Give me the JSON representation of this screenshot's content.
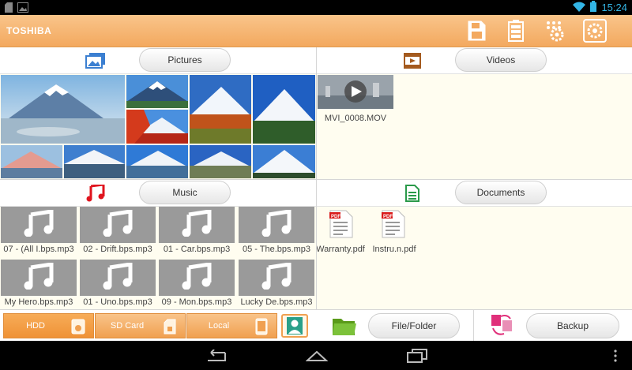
{
  "status_bar": {
    "time": "15:24",
    "left_icons": [
      "sd-card-notification-icon",
      "image-notification-icon"
    ],
    "right_icons": [
      "wifi-icon",
      "battery-icon"
    ]
  },
  "app": {
    "brand": "TOSHIBA",
    "accent": "#f5b26b",
    "header_icons": [
      "save-icon",
      "battery-status-icon",
      "settings-cluster-icon",
      "gear-icon"
    ]
  },
  "pictures": {
    "label": "Pictures",
    "icon": "pictures-icon"
  },
  "videos": {
    "label": "Videos",
    "icon": "film-icon",
    "items": [
      {
        "name": "MVI_0008.MOV"
      }
    ]
  },
  "music": {
    "label": "Music",
    "icon": "music-note-icon",
    "items": [
      {
        "name": "07 - (All I.bps.mp3"
      },
      {
        "name": "02 - Drift.bps.mp3"
      },
      {
        "name": "01 - Car.bps.mp3"
      },
      {
        "name": "05 - The.bps.mp3"
      },
      {
        "name": "My Hero.bps.mp3"
      },
      {
        "name": "01 - Uno.bps.mp3"
      },
      {
        "name": "09 - Mon.bps.mp3"
      },
      {
        "name": "Lucky De.bps.mp3"
      }
    ]
  },
  "documents": {
    "label": "Documents",
    "icon": "document-icon",
    "items": [
      {
        "name": "Warranty.pdf",
        "badge": "PDF"
      },
      {
        "name": "Instru.n.pdf",
        "badge": "PDF"
      }
    ]
  },
  "toolbar": {
    "sources": [
      {
        "label": "HDD",
        "active": true
      },
      {
        "label": "SD Card",
        "active": false
      },
      {
        "label": "Local",
        "active": false
      }
    ],
    "file_folder": "File/Folder",
    "backup": "Backup"
  }
}
